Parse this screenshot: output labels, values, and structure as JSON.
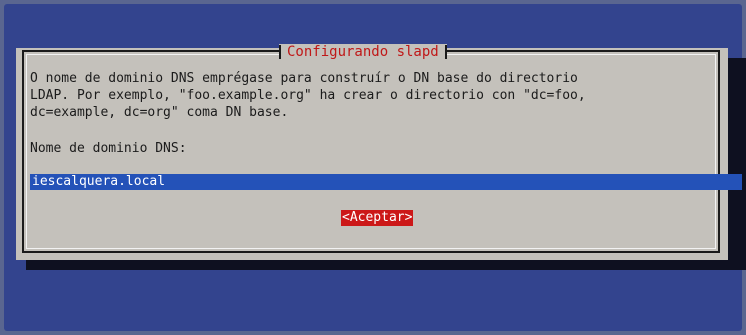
{
  "dialog": {
    "title": "Configurando slapd",
    "message_lines": [
      "O nome de dominio DNS emprégase para construír o DN base do directorio",
      "LDAP. Por exemplo, \"foo.example.org\" ha crear o directorio con \"dc=foo,",
      "dc=example, dc=org\" coma DN base."
    ],
    "field_label": "Nome de dominio DNS:",
    "field_value": "iescalquera.local",
    "ok_button": "<Aceptar>"
  },
  "colors": {
    "background": "#33448e",
    "dialog": "#c4c1bb",
    "title_text": "#c01818",
    "input_highlight": "#2452b8",
    "button_highlight": "#cc1818"
  }
}
